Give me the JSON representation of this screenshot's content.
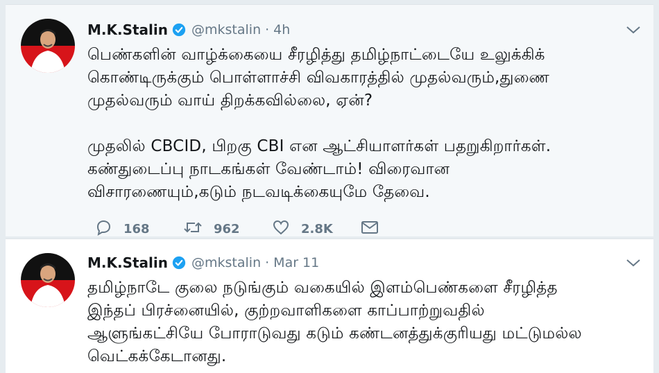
{
  "tweets": [
    {
      "name": "M.K.Stalin",
      "handle": "@mkstalin",
      "separator": "·",
      "time": "4h",
      "text": "பெண்களின் வாழ்க்கையை சீரழித்து தமிழ்நாட்டையே உலுக்கிக்\nகொண்டிருக்கும் பொள்ளாச்சி விவகாரத்தில் முதல்வரும்,துணை\nமுதல்வரும் வாய் திறக்கவில்லை, ஏன்?\n\nமுதலில் CBCID, பிறகு CBI என ஆட்சியாளர்கள் பதறுகிறார்கள்.\nகண்துடைப்பு நாடகங்கள் வேண்டாம்! விரைவான\nவிசாரணையும்,கடும் நடவடிக்கையுமே தேவை.",
      "actions": {
        "replies": "168",
        "retweets": "962",
        "likes": "2.8K"
      }
    },
    {
      "name": "M.K.Stalin",
      "handle": "@mkstalin",
      "separator": "·",
      "time": "Mar 11",
      "text": "தமிழ்நாடே குலை நடுங்கும் வகையில் இளம்பெண்களை சீரழித்த\nஇந்தப் பிரச்னையில், குற்றவாளிகளை காப்பாற்றுவதில்\nஆளுங்கட்சியே போராடுவது கடும் கண்டனத்துக்குரியது மட்டுமல்ல\nவெட்கக்கேடானது."
    }
  ],
  "colors": {
    "avatar_top": "#111111",
    "avatar_bottom": "#d7141a",
    "verified": "#1da1f2",
    "muted": "#657786"
  },
  "icons": [
    "verified-badge-icon",
    "chevron-down-icon",
    "reply-icon",
    "retweet-icon",
    "like-icon",
    "direct-message-icon"
  ]
}
